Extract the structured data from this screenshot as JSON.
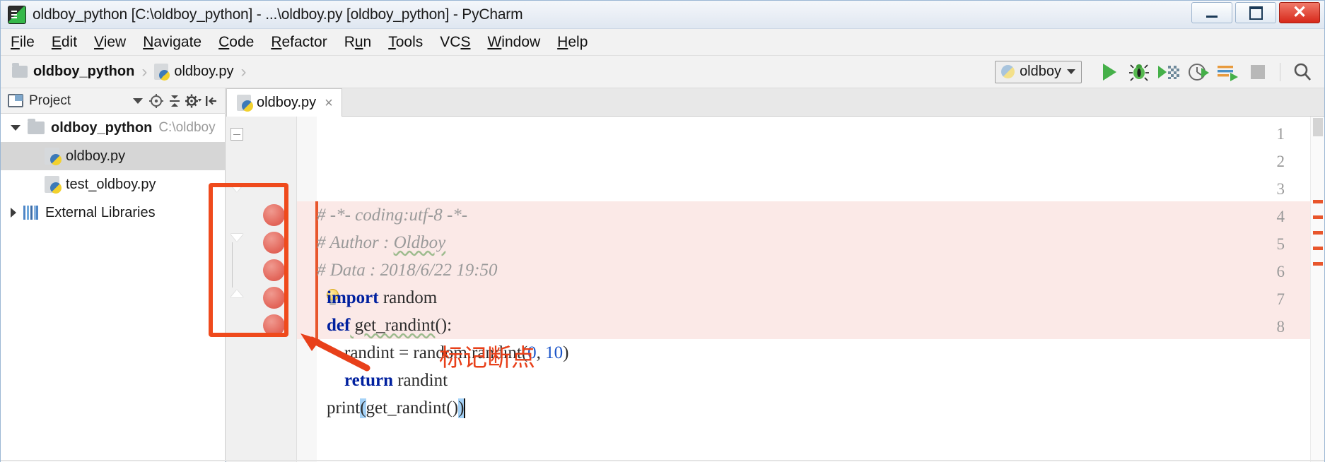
{
  "window": {
    "title": "oldboy_python [C:\\oldboy_python] - ...\\oldboy.py [oldboy_python] - PyCharm",
    "app_icon": "pycharm-icon",
    "minimize_label": "",
    "maximize_label": "",
    "close_label": "✕"
  },
  "menu": {
    "items": [
      {
        "label": "File",
        "accel": "F"
      },
      {
        "label": "Edit",
        "accel": "E"
      },
      {
        "label": "View",
        "accel": "V"
      },
      {
        "label": "Navigate",
        "accel": "N"
      },
      {
        "label": "Code",
        "accel": "C"
      },
      {
        "label": "Refactor",
        "accel": "R"
      },
      {
        "label": "Run",
        "accel": "u"
      },
      {
        "label": "Tools",
        "accel": "T"
      },
      {
        "label": "VCS",
        "accel": "S"
      },
      {
        "label": "Window",
        "accel": "W"
      },
      {
        "label": "Help",
        "accel": "H"
      }
    ]
  },
  "breadcrumb": {
    "project": "oldboy_python",
    "file": "oldboy.py",
    "separator": "›"
  },
  "toolbar": {
    "run_config": "oldboy",
    "buttons": [
      {
        "name": "run-button",
        "label": "Run"
      },
      {
        "name": "debug-button",
        "label": "Debug"
      },
      {
        "name": "run-coverage-button",
        "label": "Run with Coverage"
      },
      {
        "name": "profile-button",
        "label": "Profile"
      },
      {
        "name": "run-console-button",
        "label": "Run with Console"
      },
      {
        "name": "stop-button",
        "label": "Stop"
      },
      {
        "name": "search-button",
        "label": "Search Everywhere"
      }
    ]
  },
  "project_panel": {
    "title": "Project",
    "tools": [
      {
        "name": "collapse-dropdown",
        "label": "▾"
      },
      {
        "name": "locate-icon",
        "label": "⊕"
      },
      {
        "name": "collapse-all-icon",
        "label": "÷"
      },
      {
        "name": "settings-gear-icon",
        "label": "⚙"
      },
      {
        "name": "hide-panel-icon",
        "label": "⇤"
      }
    ],
    "tree": [
      {
        "label": "oldboy_python",
        "path_suffix": "C:\\oldboy",
        "icon": "folder-icon",
        "expanded": true,
        "selected": false,
        "indent": 0
      },
      {
        "label": "oldboy.py",
        "path_suffix": "",
        "icon": "python-file-icon",
        "expanded": false,
        "selected": true,
        "indent": 1
      },
      {
        "label": "test_oldboy.py",
        "path_suffix": "",
        "icon": "python-file-icon",
        "expanded": false,
        "selected": false,
        "indent": 1
      },
      {
        "label": "External Libraries",
        "path_suffix": "",
        "icon": "library-icon",
        "expanded": false,
        "selected": false,
        "indent": 0
      }
    ]
  },
  "editor": {
    "tab": {
      "label": "oldboy.py",
      "close": "×",
      "icon": "python-file-icon"
    },
    "lines": [
      {
        "number": "1",
        "breakpoint": false,
        "highlighted": false,
        "tokens": [
          {
            "text": "# -*- coding:utf-8 -*-",
            "kind": "comment"
          }
        ]
      },
      {
        "number": "2",
        "breakpoint": false,
        "highlighted": false,
        "tokens": [
          {
            "text": "# Author : ",
            "kind": "comment"
          },
          {
            "text": "Oldboy",
            "kind": "comment-spell"
          }
        ]
      },
      {
        "number": "3",
        "breakpoint": false,
        "highlighted": false,
        "tokens": [
          {
            "text": "# Data : 2018/6/22 19:50",
            "kind": "comment"
          }
        ]
      },
      {
        "number": "4",
        "breakpoint": true,
        "highlighted": true,
        "tokens": [
          {
            "text": "import",
            "kind": "keyword"
          },
          {
            "text": " random",
            "kind": "plain"
          }
        ]
      },
      {
        "number": "5",
        "breakpoint": true,
        "highlighted": true,
        "tokens": [
          {
            "text": "def",
            "kind": "keyword"
          },
          {
            "text": " get_randint",
            "kind": "plain-spell"
          },
          {
            "text": "():",
            "kind": "plain"
          }
        ]
      },
      {
        "number": "6",
        "breakpoint": true,
        "highlighted": true,
        "tokens": [
          {
            "text": "    randint = random.randint",
            "kind": "plain"
          },
          {
            "text": "(",
            "kind": "plain"
          },
          {
            "text": "0",
            "kind": "number"
          },
          {
            "text": ", ",
            "kind": "plain"
          },
          {
            "text": "10",
            "kind": "number"
          },
          {
            "text": ")",
            "kind": "plain"
          }
        ]
      },
      {
        "number": "7",
        "breakpoint": true,
        "highlighted": true,
        "bulb": true,
        "tokens": [
          {
            "text": "    ",
            "kind": "plain"
          },
          {
            "text": "return",
            "kind": "keyword"
          },
          {
            "text": " randint",
            "kind": "plain"
          }
        ]
      },
      {
        "number": "8",
        "breakpoint": true,
        "highlighted": true,
        "caret": true,
        "tokens": [
          {
            "text": "print",
            "kind": "plain"
          },
          {
            "text": "(",
            "kind": "bracket-match"
          },
          {
            "text": "get_randint()",
            "kind": "plain"
          },
          {
            "text": ")",
            "kind": "bracket-match"
          }
        ]
      }
    ]
  },
  "annotation": {
    "caption": "标记断点",
    "color": "#e8401a",
    "box_color": "#ef4a1c",
    "arrow_name": "callout-arrow"
  },
  "colors": {
    "keyword": "#00209f",
    "comment": "#9a9a9a",
    "number": "#1a54c8",
    "breakpoint": "#e3675b",
    "highlight_row": "#fbe9e7",
    "bracket_match": "#a5d2f7",
    "accent_green": "#45b049"
  }
}
